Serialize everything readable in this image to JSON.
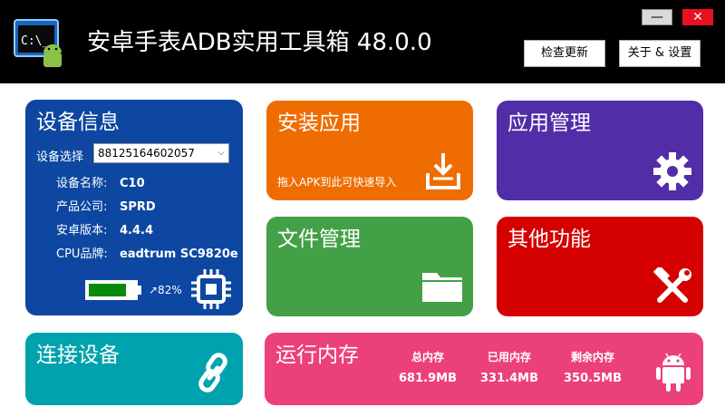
{
  "window": {
    "title": "安卓手表ADB实用工具箱  48.0.0",
    "min_label": "—",
    "close_label": "✕",
    "icon": "terminal-android-icon",
    "icon_text": "C:\\_"
  },
  "toolbar": {
    "check_update_label": "检查更新",
    "about_label": "关于 & 设置"
  },
  "device_info": {
    "title": "设备信息",
    "select_label": "设备选择",
    "selected_device": "88125164602057",
    "rows": [
      {
        "key": "设备名称:",
        "value": "C10"
      },
      {
        "key": "产品公司:",
        "value": "SPRD"
      },
      {
        "key": "安卓版本:",
        "value": "4.4.4"
      },
      {
        "key": "CPU品牌:",
        "value": "eadtrum SC9820e"
      }
    ],
    "battery_percent_label": "↗82%",
    "battery_level": 0.82,
    "chip_icon": "cpu-chip-icon"
  },
  "tiles": {
    "install": {
      "title": "安装应用",
      "hint": "拖入APK到此可快速导入",
      "icon": "download-tray-icon"
    },
    "app_manager": {
      "title": "应用管理",
      "icon": "gear-icon"
    },
    "file_manager": {
      "title": "文件管理",
      "icon": "folder-icon"
    },
    "other": {
      "title": "其他功能",
      "icon": "tools-icon"
    },
    "connect": {
      "title": "连接设备",
      "icon": "link-icon"
    },
    "memory": {
      "title": "运行内存",
      "columns": [
        {
          "label": "总内存",
          "value": "681.9MB"
        },
        {
          "label": "已用内存",
          "value": "331.4MB"
        },
        {
          "label": "剩余内存",
          "value": "350.5MB"
        }
      ],
      "icon": "android-icon"
    }
  },
  "colors": {
    "titlebar": "#000000",
    "device_info": "#0d47a1",
    "install": "#ef6c00",
    "app_manager": "#512da8",
    "file_manager": "#43a047",
    "other": "#d50000",
    "connect": "#00a3ad",
    "memory": "#ec407a",
    "battery_fill": "#0a8a0a"
  }
}
